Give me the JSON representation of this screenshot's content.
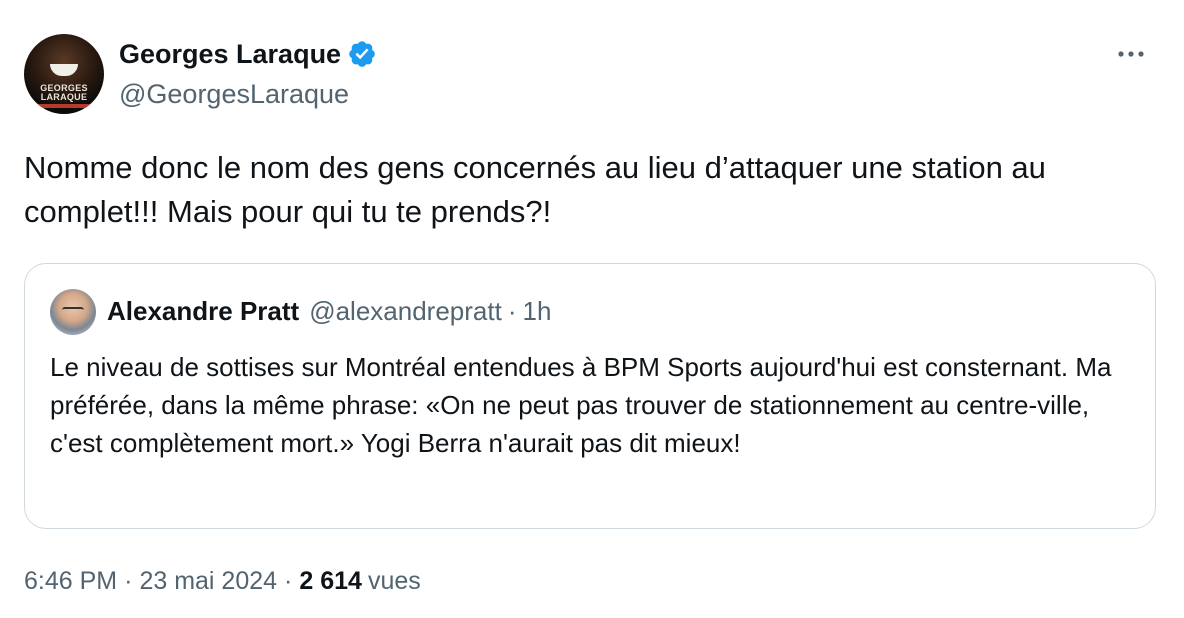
{
  "author": {
    "display_name": "Georges Laraque",
    "handle": "@GeorgesLaraque",
    "verified": true,
    "avatar_text": "GEORGES LARAQUE",
    "verified_color": "#1d9bf0"
  },
  "tweet": {
    "text": "Nomme donc le nom des gens concernés au lieu d’attaquer une station au complet!!! Mais pour qui tu te prends?!"
  },
  "quoted": {
    "display_name": "Alexandre Pratt",
    "handle": "@alexandrepratt",
    "separator": "·",
    "time": "1h",
    "text": "Le niveau de sottises sur Montréal entendues à BPM Sports aujourd'hui est consternant. Ma préférée, dans la même phrase: «On ne peut pas trouver de stationnement au centre-ville, c'est complètement mort.» Yogi Berra n'aurait pas dit mieux!"
  },
  "meta": {
    "time": "6:46 PM",
    "separator": "·",
    "date": "23 mai 2024",
    "views_count": "2 614",
    "views_label": "vues"
  },
  "icons": {
    "more": "more-horizontal-icon",
    "verified": "verified-badge-icon"
  },
  "colors": {
    "text": "#0f1419",
    "secondary": "#536471",
    "border": "#cfd9de",
    "accent": "#1d9bf0"
  }
}
